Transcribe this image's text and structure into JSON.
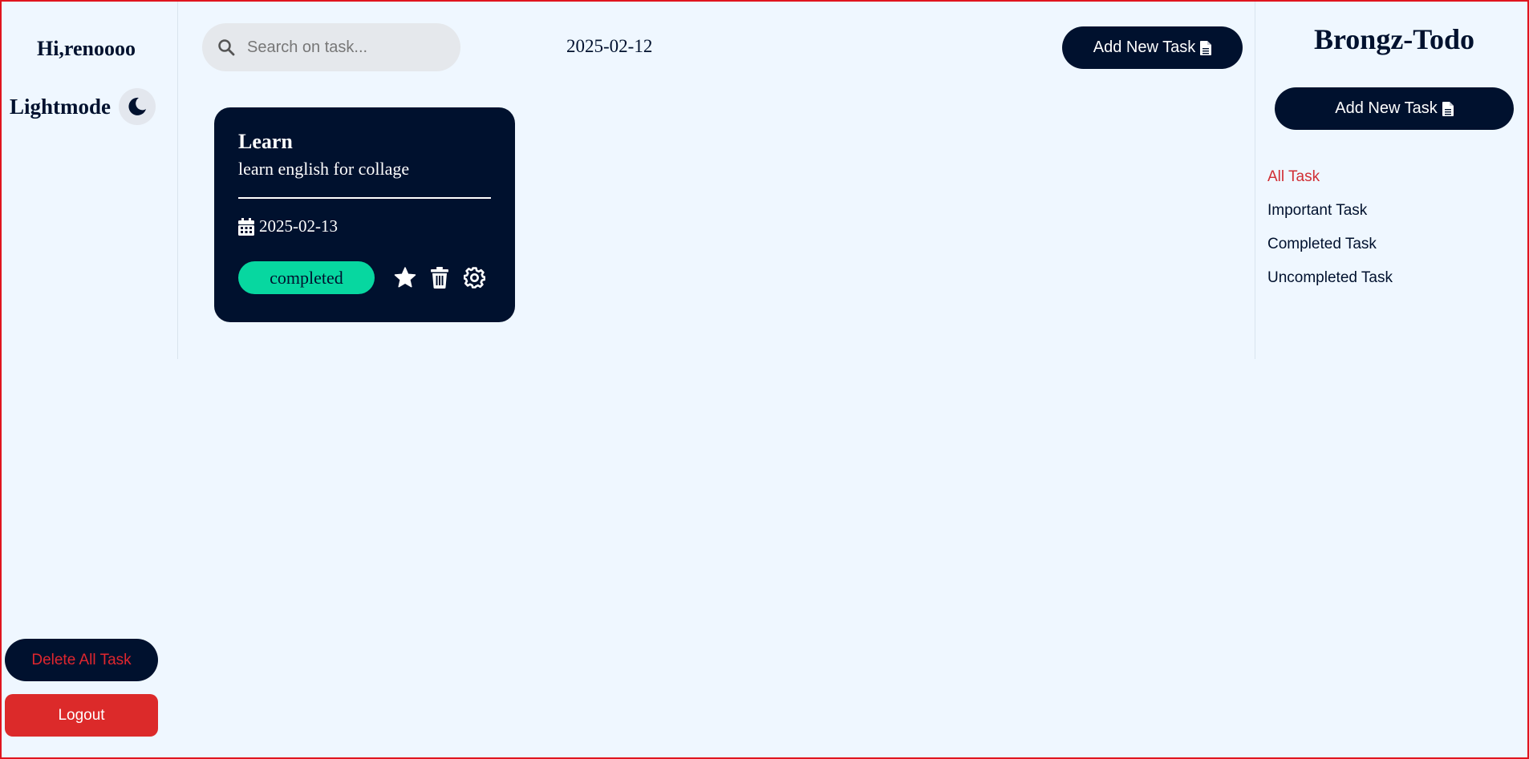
{
  "left": {
    "greeting": "Hi,renoooo",
    "mode_label": "Lightmode",
    "mode_icon": "moon-icon",
    "delete_all_label": "Delete All Task",
    "logout_label": "Logout"
  },
  "header": {
    "search_placeholder": "Search on task...",
    "search_value": "",
    "date": "2025-02-12",
    "add_task_label": "Add New Task"
  },
  "tasks": [
    {
      "title": "Learn",
      "description": "learn english for collage",
      "date": "2025-02-13",
      "status": "completed",
      "actions": [
        "star-icon",
        "trash-icon",
        "gear-icon"
      ]
    }
  ],
  "right": {
    "brand": "Brongz-Todo",
    "add_task_label": "Add New Task",
    "nav": [
      {
        "label": "All Task",
        "active": true
      },
      {
        "label": "Important Task",
        "active": false
      },
      {
        "label": "Completed Task",
        "active": false
      },
      {
        "label": "Uncompleted Task",
        "active": false
      }
    ]
  },
  "colors": {
    "background": "#eff7ff",
    "navy": "#00112e",
    "accent_red": "#dc2a2a",
    "status_green": "#07d7a0",
    "frame": "#e0151f"
  }
}
